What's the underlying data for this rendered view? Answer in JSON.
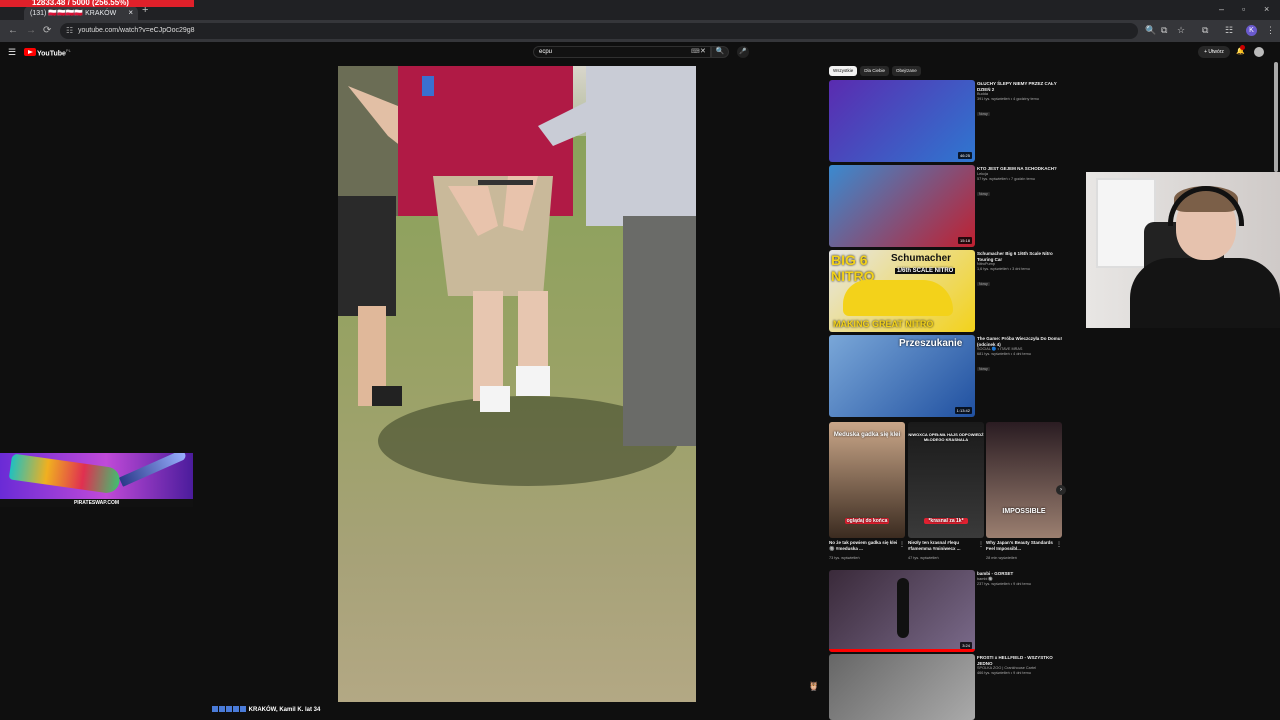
{
  "browser": {
    "overlay_banner": "12833.48 / 5000 (256.55%)",
    "tab_label": "(131) 🇵🇱🇵🇱🇵🇱🇵🇱 KRAKÓW",
    "tab_close": "×",
    "new_tab": "+",
    "url": "youtube.com/watch?v=eCJpOoc29g8",
    "window_controls": [
      "–",
      "▫",
      "×"
    ],
    "profile_initial": "K"
  },
  "youtube": {
    "search_query": "ecpu",
    "create_label": "+ Utwórz",
    "logo_text": "YouTube",
    "logo_sup": "PL",
    "chips": [
      "Wszystkie",
      "Dla Ciebie",
      "Obejrzane"
    ],
    "recommendations": [
      {
        "title": "GŁUCHY ŚLEPY NIEMY PRZEZ CAŁY DZIEŃ 2",
        "channel": "Budda",
        "meta": "391 tys. wyświetleń • 4 godziny temu",
        "badge": "Nowy",
        "duration": "46:25",
        "colors": [
          "#5a2bb0",
          "#2f77d0"
        ]
      },
      {
        "title": "KTO JEST GEJEM NA SCHODKACH?",
        "channel": "Lekcja",
        "meta": "57 tys. wyświetleń • 7 godzin temu",
        "badge": "Nowy",
        "duration": "15:18",
        "colors": [
          "#3a8ad0",
          "#c02030"
        ]
      },
      {
        "title": "Schumacher Big 6 1/6th Scale Nitro Touring Car",
        "channel": "NitroPump",
        "meta": "1,6 tys. wyświetleń • 3 dni temu",
        "badge": "Nowy",
        "duration": "",
        "colors": [
          "#e6e6e6",
          "#f3d21a"
        ]
      },
      {
        "title": "The Game: Próba Wieczczyła Do Domu! (odcinek 4)",
        "channel": "SOCIAL 🔵 • ITAVE MRAS",
        "meta": "681 tys. wyświetleń • 4 dni temu",
        "badge": "Nowy",
        "duration": "1:13:42",
        "colors": [
          "#7aa7d8",
          "#2050a0"
        ]
      },
      {
        "title": "bambi - GORSET",
        "channel": "bambi 🔘",
        "meta": "237 tys. wyświetleń • 9 dni temu",
        "badge": "",
        "duration": "3:24",
        "colors": [
          "#3a2a3a",
          "#7a6a8a"
        ]
      },
      {
        "title": "FROSTI x HELLFIELD - WSZYSTKO JEDNO",
        "channel": "SPOLKA ZOO | Crankhouse Cartel",
        "meta": "466 tys. wyświetleń • 9 dni temu",
        "badge": "",
        "duration": "",
        "colors": [
          "#666",
          "#aaa"
        ]
      }
    ],
    "shorts": [
      {
        "title": "No że tak powiem gadka się klei 🔘 #meduska ...",
        "views": "73 tys. wyświetleń",
        "top_text": "Meduska gadka się klei",
        "bottom_text": "oglądaj do końca",
        "colors": [
          "#caa789",
          "#3b2b20"
        ]
      },
      {
        "title": "Niezły ten krasnal #lequ #famemma #miniwecx ...",
        "views": "47 tys. wyświetleń",
        "top_text": "NIWOXCA OPEŁNIŁ HAJS ODPOWIEDŹ MŁODEGO KRASNALA",
        "bottom_text": "*krasnal za 1k*",
        "colors": [
          "#1a1a1a",
          "#3a3a3a"
        ]
      },
      {
        "title": "Why Japan's Beauty Standards Feel Impossibl...",
        "views": "28 mln wyświetleń",
        "top_text": "",
        "bottom_text": "IMPOSSIBLE",
        "colors": [
          "#2a1c22",
          "#9b7f70"
        ]
      }
    ]
  },
  "stream_overlay": {
    "caption": "KRAKÓW, Kamil K. lat 34",
    "sponsor_url": "PIRATESWAP.COM"
  },
  "icons": {
    "back": "←",
    "forward": "→",
    "reload": "⟳",
    "menu": "☰",
    "search": "🔍",
    "mic": "🎤",
    "bell": "🔔",
    "keyboard": "⌨",
    "clear": "✕",
    "chevron_right": "›",
    "more": "⋮",
    "zoom": "🔍",
    "star": "☆",
    "extensions": "⧉",
    "tune": "☷",
    "owl": "🦉"
  }
}
